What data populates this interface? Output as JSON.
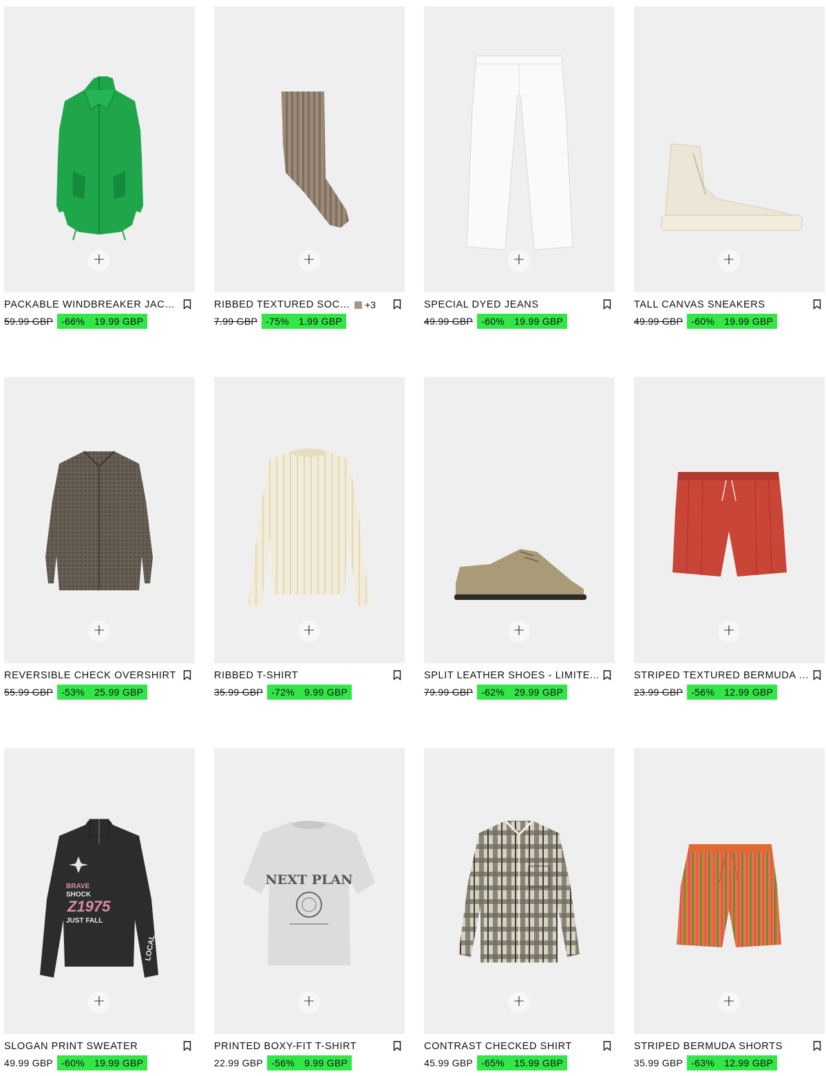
{
  "products": [
    {
      "name": "PACKABLE WINDBREAKER JACKET",
      "image_icon": "green-windbreaker-jacket-icon",
      "old_price": "59.99 GBP",
      "old_price_struck": true,
      "discount": "-66%",
      "sale_price": "19.99 GBP"
    },
    {
      "name": "RIBBED TEXTURED SOCKS",
      "image_icon": "brown-ribbed-sock-icon",
      "colors_more": "+3",
      "swatch_color": "#a89684",
      "old_price": "7.99 GBP",
      "old_price_struck": true,
      "discount": "-75%",
      "sale_price": "1.99 GBP"
    },
    {
      "name": "SPECIAL DYED JEANS",
      "image_icon": "white-jeans-icon",
      "old_price": "49.99 GBP",
      "old_price_struck": true,
      "discount": "-60%",
      "sale_price": "19.99 GBP"
    },
    {
      "name": "TALL CANVAS SNEAKERS",
      "image_icon": "cream-high-top-sneaker-icon",
      "old_price": "49.99 GBP",
      "old_price_struck": true,
      "discount": "-60%",
      "sale_price": "19.99 GBP"
    },
    {
      "name": "REVERSIBLE CHECK OVERSHIRT",
      "image_icon": "brown-check-overshirt-icon",
      "old_price": "55.99 GBP",
      "old_price_struck": true,
      "discount": "-53%",
      "sale_price": "25.99 GBP"
    },
    {
      "name": "RIBBED T-SHIRT",
      "image_icon": "cream-ribbed-longsleeve-icon",
      "old_price": "35.99 GBP",
      "old_price_struck": true,
      "discount": "-72%",
      "sale_price": "9.99 GBP"
    },
    {
      "name": "SPLIT LEATHER SHOES - LIMITE...",
      "image_icon": "beige-suede-shoe-icon",
      "old_price": "79.99 GBP",
      "old_price_struck": true,
      "discount": "-62%",
      "sale_price": "29.99 GBP"
    },
    {
      "name": "STRIPED TEXTURED BERMUDA S...",
      "image_icon": "red-bermuda-shorts-icon",
      "old_price": "23.99 GBP",
      "old_price_struck": true,
      "discount": "-56%",
      "sale_price": "12.99 GBP"
    },
    {
      "name": "SLOGAN PRINT SWEATER",
      "image_icon": "black-slogan-sweater-icon",
      "old_price": "49.99 GBP",
      "old_price_struck": false,
      "discount": "-60%",
      "sale_price": "19.99 GBP"
    },
    {
      "name": "PRINTED BOXY-FIT T-SHIRT",
      "image_icon": "grey-printed-tshirt-icon",
      "old_price": "22.99 GBP",
      "old_price_struck": false,
      "discount": "-56%",
      "sale_price": "9.99 GBP"
    },
    {
      "name": "CONTRAST CHECKED SHIRT",
      "image_icon": "plaid-shirt-icon",
      "old_price": "45.99 GBP",
      "old_price_struck": false,
      "discount": "-65%",
      "sale_price": "15.99 GBP"
    },
    {
      "name": "STRIPED BERMUDA SHORTS",
      "image_icon": "orange-striped-shorts-icon",
      "old_price": "35.99 GBP",
      "old_price_struck": false,
      "discount": "-63%",
      "sale_price": "12.99 GBP"
    }
  ],
  "print_text": {
    "sweater_brave": "BRAVE",
    "sweater_shock": "SHOCK",
    "sweater_z": "Z1975",
    "sweater_fall": "JUST FALL",
    "sweater_local": "LOCAL",
    "tshirt_slogan": "NEXT PLAN"
  },
  "add_label": "+",
  "colors": {
    "sale_bg": "#32e647",
    "image_bg": "#efeff0"
  }
}
